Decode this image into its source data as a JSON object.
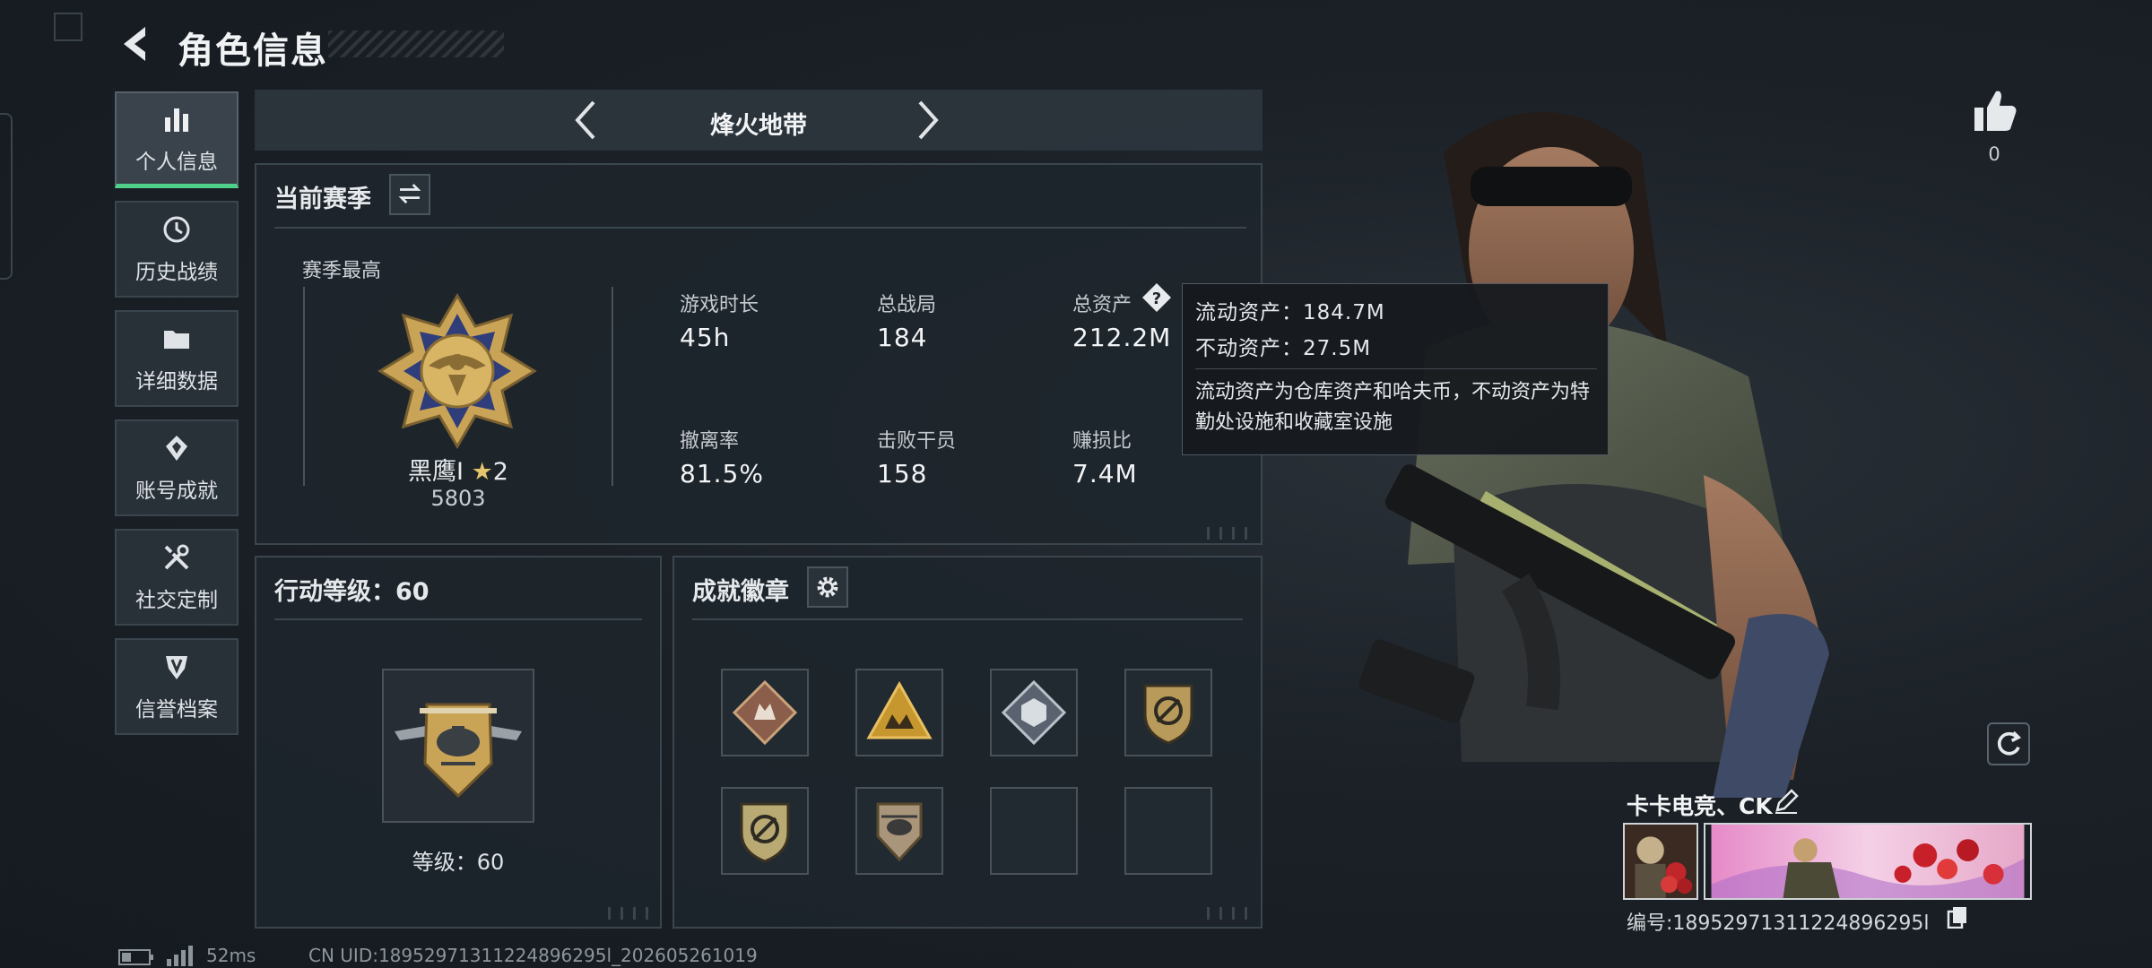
{
  "page": {
    "title": "角色信息"
  },
  "sidebar": {
    "items": [
      {
        "label": "个人信息",
        "icon": "bar-chart-icon",
        "active": true
      },
      {
        "label": "历史战绩",
        "icon": "history-icon",
        "active": false
      },
      {
        "label": "详细数据",
        "icon": "folder-icon",
        "active": false
      },
      {
        "label": "账号成就",
        "icon": "medal-icon",
        "active": false
      },
      {
        "label": "社交定制",
        "icon": "tools-icon",
        "active": false
      },
      {
        "label": "信誉档案",
        "icon": "shield-badge-icon",
        "active": false
      }
    ]
  },
  "mode": {
    "name": "烽火地带"
  },
  "season": {
    "title": "当前赛季",
    "best_label": "赛季最高",
    "rank_name": "黑鹰I",
    "rank_star": "★",
    "rank_stars": "2",
    "rank_score": "5803",
    "stats": [
      {
        "label": "游戏时长",
        "value": "45h"
      },
      {
        "label": "总战局",
        "value": "184"
      },
      {
        "label": "总资产",
        "value": "212.2M"
      },
      {
        "label": "撤离率",
        "value": "81.5%"
      },
      {
        "label": "击败干员",
        "value": "158"
      },
      {
        "label": "赚损比",
        "value": "7.4M"
      }
    ]
  },
  "tooltip": {
    "liquid": "流动资产：184.7M",
    "fixed": "不动资产：27.5M",
    "description": "流动资产为仓库资产和哈夫币，不动资产为特勤处设施和收藏室设施"
  },
  "level": {
    "title": "行动等级：60",
    "label": "等级：60"
  },
  "achievements": {
    "title": "成就徽章",
    "slots": [
      {
        "icon": "wolf-diamond-badge-icon",
        "empty": false
      },
      {
        "icon": "triangle-emblem-badge-icon",
        "empty": false
      },
      {
        "icon": "cube-diamond-badge-icon",
        "empty": false
      },
      {
        "icon": "shield-slash-badge-icon",
        "empty": false
      },
      {
        "icon": "shield-slash-badge-icon",
        "empty": false
      },
      {
        "icon": "helicopter-badge-icon",
        "empty": false
      },
      {
        "icon": "",
        "empty": true
      },
      {
        "icon": "",
        "empty": true
      }
    ]
  },
  "footer": {
    "ping": "52ms",
    "uid": "CN UID:18952971311224896295l_202605261019"
  },
  "profile": {
    "likes": "0",
    "name": "卡卡电竞、CK",
    "id": "编号:18952971311224896295l"
  },
  "colors": {
    "accent_green": "#4fd08a",
    "gold": "#d9b15c",
    "background": "#1b2127"
  }
}
